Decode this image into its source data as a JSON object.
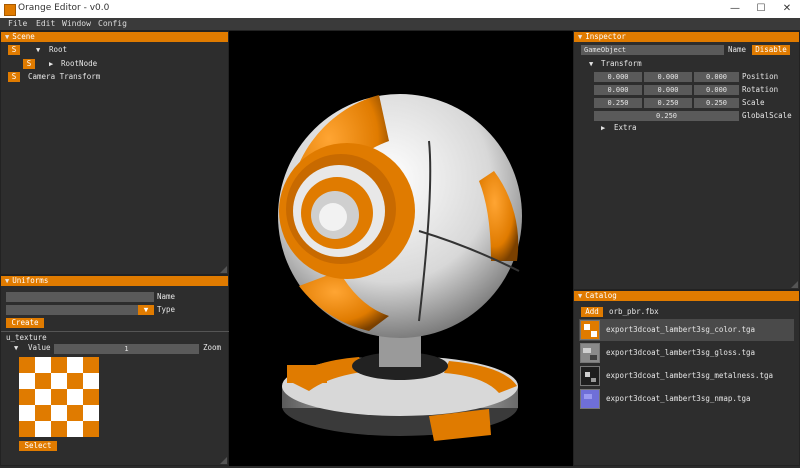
{
  "window": {
    "title": "Orange Editor - v0.0",
    "min": "—",
    "max": "☐",
    "close": "✕"
  },
  "menu": {
    "items": [
      "File",
      "Edit",
      "Window",
      "Config"
    ]
  },
  "colors": {
    "accent": "#e07b00",
    "panel": "#2d2d2d",
    "field": "#5a5a5a"
  },
  "scene": {
    "title": "Scene",
    "rows": [
      {
        "btn": "S",
        "arrow": "▼",
        "label": "Root"
      },
      {
        "btn": "S",
        "arrow": "▶",
        "label": "RootNode"
      },
      {
        "btn": "S",
        "arrow": "",
        "label": "Camera Transform"
      }
    ]
  },
  "uniforms": {
    "title": "Uniforms",
    "name_label": "Name",
    "type_label": "Type",
    "create_label": "Create",
    "texture_label": "u_texture",
    "value_label": "Value",
    "value": "1",
    "zoom_label": "Zoom",
    "select_label": "Select"
  },
  "inspector": {
    "title": "Inspector",
    "object_name": "GameObject",
    "name_label": "Name",
    "disable_label": "Disable",
    "transform_label": "Transform",
    "position": {
      "label": "Position",
      "values": [
        "0.000",
        "0.000",
        "0.000"
      ]
    },
    "rotation": {
      "label": "Rotation",
      "values": [
        "0.000",
        "0.000",
        "0.000"
      ]
    },
    "scale": {
      "label": "Scale",
      "values": [
        "0.250",
        "0.250",
        "0.250"
      ]
    },
    "global_scale": {
      "label": "GlobalScale",
      "value": "0.250"
    },
    "extra_label": "Extra"
  },
  "catalog": {
    "title": "Catalog",
    "add_label": "Add",
    "first_file": "orb_pbr.fbx",
    "files": [
      {
        "name": "export3dcoat_lambert3sg_color.tga",
        "icon": "texture-color-icon",
        "color": "#e07b00"
      },
      {
        "name": "export3dcoat_lambert3sg_gloss.tga",
        "icon": "texture-gloss-icon",
        "color": "#8a8a8a"
      },
      {
        "name": "export3dcoat_lambert3sg_metalness.tga",
        "icon": "texture-metalness-icon",
        "color": "#1e1e1e"
      },
      {
        "name": "export3dcoat_lambert3sg_nmap.tga",
        "icon": "texture-nmap-icon",
        "color": "#6f6fd8"
      }
    ]
  }
}
